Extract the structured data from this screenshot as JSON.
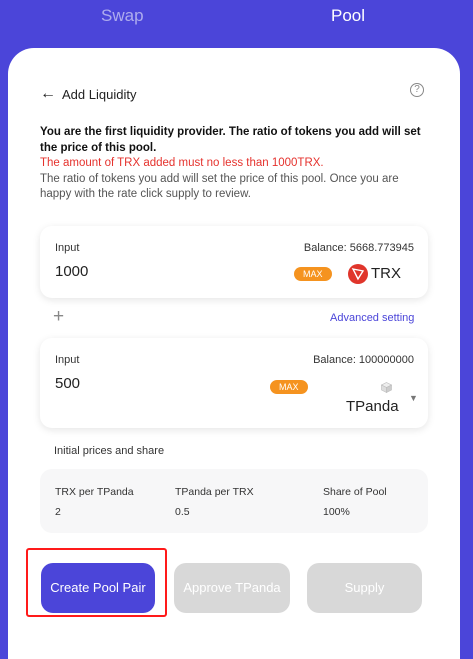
{
  "tabs": {
    "swap": "Swap",
    "pool": "Pool"
  },
  "header": {
    "back_icon": "←",
    "title": "Add Liquidity",
    "help_icon": "?"
  },
  "notice": {
    "bold": "You are the first liquidity provider. The ratio of tokens you add will set the price of this pool.",
    "warning": "The amount of TRX added must no less than 1000TRX.",
    "info": "The ratio of tokens you add will set the price of this pool. Once you are happy with the rate click supply to review."
  },
  "input1": {
    "label": "Input",
    "balance": "Balance: 5668.773945",
    "value": "1000",
    "max_label": "MAX",
    "token": "TRX",
    "token_icon": "tron-icon"
  },
  "plus_icon": "+",
  "advanced_setting": "Advanced setting",
  "input2": {
    "label": "Input",
    "balance": "Balance: 100000000",
    "value": "500",
    "max_label": "MAX",
    "token": "TPanda",
    "token_icon": "cube-icon",
    "caret": "▼"
  },
  "prices": {
    "title": "Initial prices and share",
    "columns": [
      {
        "header": "TRX per TPanda",
        "value": "2"
      },
      {
        "header": "TPanda per TRX",
        "value": "0.5"
      },
      {
        "header": "Share of Pool",
        "value": "100%"
      }
    ]
  },
  "buttons": {
    "create": "Create Pool Pair",
    "approve": "Approve TPanda",
    "supply": "Supply"
  },
  "colors": {
    "accent": "#4b45d9",
    "max": "#f5931f",
    "warning": "#e5322d",
    "disabled": "#d8d8d8",
    "highlight": "#ff1a1a"
  }
}
